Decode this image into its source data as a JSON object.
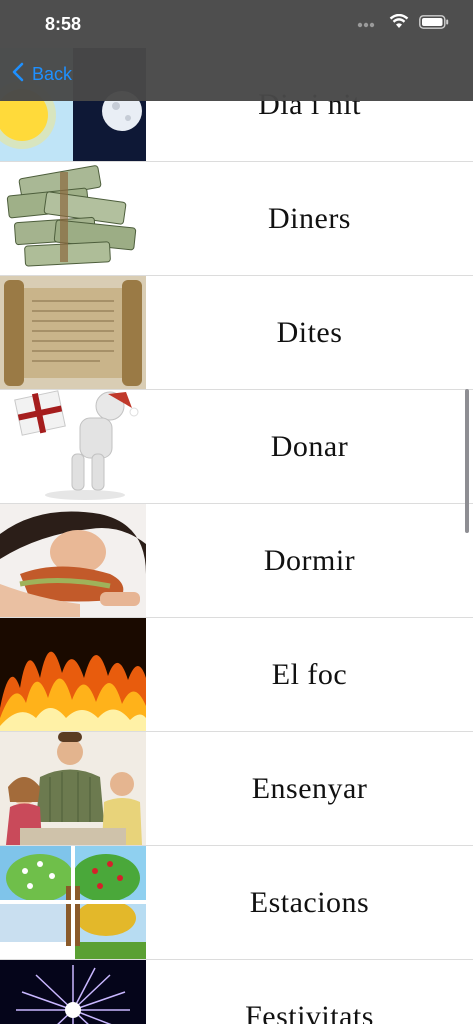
{
  "status_bar": {
    "time": "8:58",
    "icons": [
      "signal-dots-icon",
      "wifi-icon",
      "battery-icon"
    ]
  },
  "nav": {
    "back_label": "Back",
    "back_icon": "chevron-left-icon"
  },
  "list": {
    "items": [
      {
        "label": "Dia i nit",
        "thumbnail": "day-night-image"
      },
      {
        "label": "Diners",
        "thumbnail": "money-stacks-image"
      },
      {
        "label": "Dites",
        "thumbnail": "scroll-parchment-image"
      },
      {
        "label": "Donar",
        "thumbnail": "figure-with-gift-image"
      },
      {
        "label": "Dormir",
        "thumbnail": "sleeping-woman-image"
      },
      {
        "label": "El foc",
        "thumbnail": "fire-flames-image"
      },
      {
        "label": "Ensenyar",
        "thumbnail": "family-portrait-image"
      },
      {
        "label": "Estacions",
        "thumbnail": "four-seasons-tree-image"
      },
      {
        "label": "Festivitats",
        "thumbnail": "fireworks-image"
      }
    ]
  },
  "colors": {
    "accent": "#1e90ff",
    "nav_bg": "#484848"
  }
}
